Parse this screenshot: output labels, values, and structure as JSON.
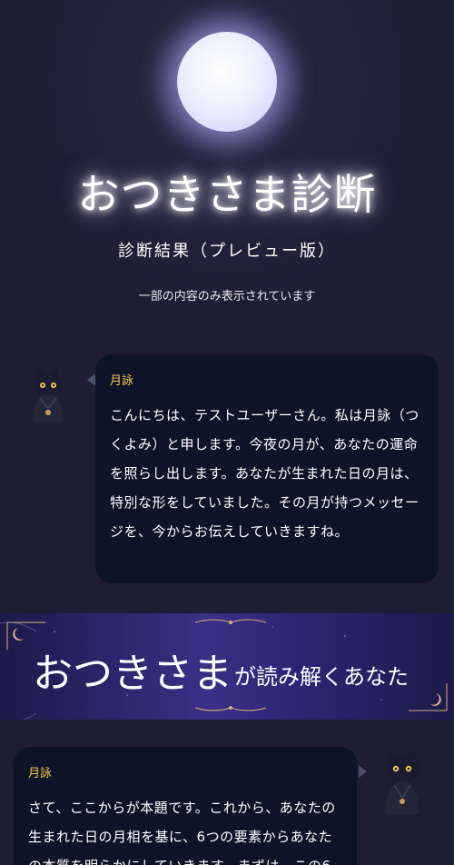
{
  "hero": {
    "title": "おつきさま診断",
    "subtitle": "診断結果（プレビュー版）",
    "note": "一部の内容のみ表示されています"
  },
  "messages": [
    {
      "speaker": "月詠",
      "text": "こんにちは、テストユーザーさん。私は月詠（つくよみ）と申します。今夜の月が、あなたの運命を照らし出します。あなたが生まれた日の月は、特別な形をしていました。その月が持つメッセージを、今からお伝えしていきますね。"
    },
    {
      "speaker": "月詠",
      "text": "さて、ここからが本題です。これから、あなたの生まれた日の月相を基に、6つの要素からあなたの本質を明らかにしていきます。まずは、この6"
    }
  ],
  "banner": {
    "main": "おつきさま",
    "sub": "が読み解くあなた"
  },
  "colors": {
    "background": "#1f1d33",
    "bubble": "#0e1428",
    "speaker_name": "#f3c94b",
    "banner": "#3a2f86",
    "accent_gold": "#d9b27a"
  }
}
